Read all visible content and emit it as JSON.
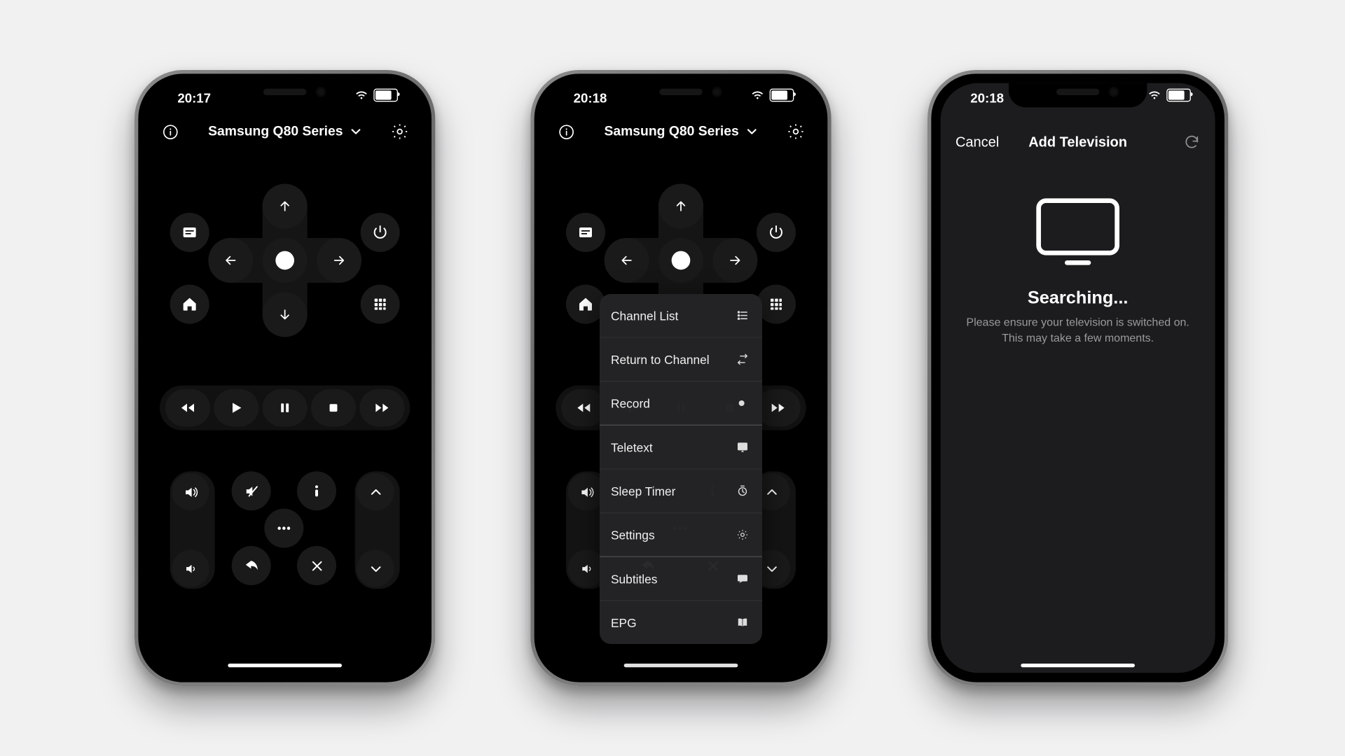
{
  "statusbar": {
    "time1": "20:17",
    "time2": "20:18",
    "time3": "20:18"
  },
  "header": {
    "device": "Samsung Q80 Series"
  },
  "popup": {
    "items": [
      {
        "label": "Channel List",
        "icon": "list-icon"
      },
      {
        "label": "Return to Channel",
        "icon": "swap-icon"
      },
      {
        "label": "Record",
        "icon": "dot-icon"
      },
      {
        "label": "Teletext",
        "icon": "teletext-icon"
      },
      {
        "label": "Sleep Timer",
        "icon": "timer-icon"
      },
      {
        "label": "Settings",
        "icon": "gear-icon"
      },
      {
        "label": "Subtitles",
        "icon": "cc-icon"
      },
      {
        "label": "EPG",
        "icon": "book-icon"
      }
    ]
  },
  "addtv": {
    "cancel": "Cancel",
    "title": "Add Television",
    "searching": "Searching...",
    "hint1": "Please ensure your television is switched on.",
    "hint2": "This may take a few moments."
  }
}
